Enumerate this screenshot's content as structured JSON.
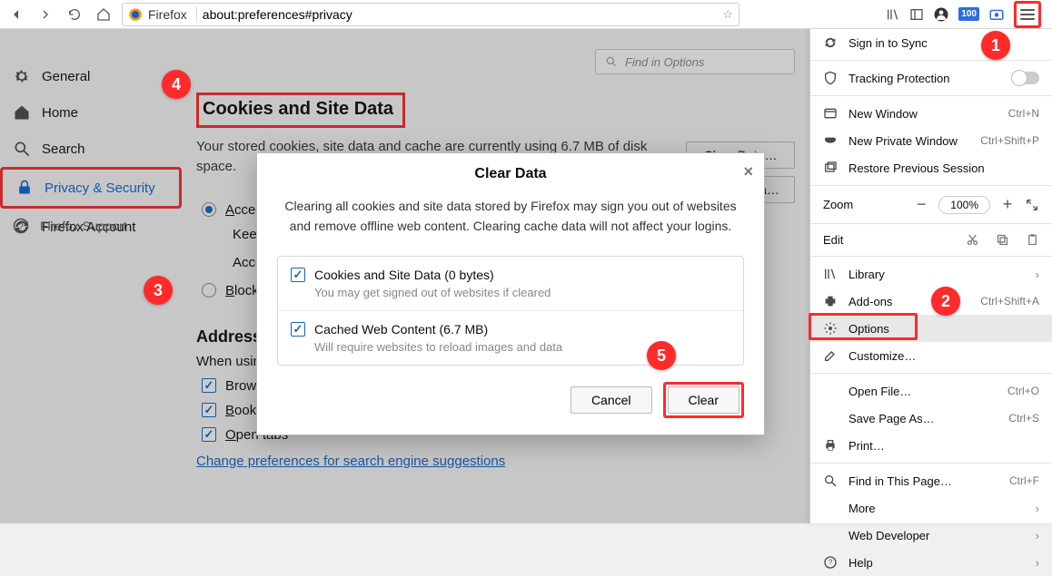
{
  "toolbar": {
    "brand": "Firefox",
    "url": "about:preferences#privacy"
  },
  "prefs": {
    "find_placeholder": "Find in Options",
    "nav": {
      "general": "General",
      "home": "Home",
      "search": "Search",
      "privacy": "Privacy & Security",
      "account": "Firefox Account",
      "support": "Firefox Support"
    },
    "cookies": {
      "title": "Cookies and Site Data",
      "desc": "Your stored cookies, site data and cache are currently using 6.7 MB of disk space.",
      "clear_btn": "Clear Data…",
      "manage_btn": "Manage Data…",
      "radio_accept_prefix": "A",
      "radio_accept_rest": "ccept cookies and site data from websites (recommended)",
      "keep_label": "Keep until",
      "accept_third": "Accept third-party cookies and site data",
      "radio_block_prefix": "B",
      "radio_block_rest": "lock cookies and site data (may cause websites to break)"
    },
    "address": {
      "title": "Address Bar",
      "desc": "When using the address bar, suggest",
      "history": "Browsing history",
      "history_u": "h",
      "bookmarks": "Bookmarks",
      "bookmarks_u": "B",
      "tabs": "pen tabs",
      "tabs_u": "O",
      "link": "Change preferences for search engine suggestions"
    }
  },
  "dialog": {
    "title": "Clear Data",
    "body": "Clearing all cookies and site data stored by Firefox may sign you out of websites and remove offline web content. Clearing cache data will not affect your logins.",
    "opt1_title": "Cookies and Site Data (0 bytes)",
    "opt1_sub": "You may get signed out of websites if cleared",
    "opt2_title": "Cached Web Content (6.7 MB)",
    "opt2_sub": "Will require websites to reload images and data",
    "cancel": "Cancel",
    "clear": "Clear"
  },
  "menu": {
    "sign_in": "Sign in to Sync",
    "tracking": "Tracking Protection",
    "new_window": "New Window",
    "new_window_sc": "Ctrl+N",
    "new_private": "New Private Window",
    "new_private_sc": "Ctrl+Shift+P",
    "restore": "Restore Previous Session",
    "zoom": "Zoom",
    "zoom_val": "100%",
    "edit": "Edit",
    "library": "Library",
    "addons": "Add-ons",
    "addons_sc": "Ctrl+Shift+A",
    "options": "Options",
    "customize": "Customize…",
    "open_file": "Open File…",
    "open_file_sc": "Ctrl+O",
    "save_as": "Save Page As…",
    "save_as_sc": "Ctrl+S",
    "print": "Print…",
    "find": "Find in This Page…",
    "find_sc": "Ctrl+F",
    "more": "More",
    "web_dev": "Web Developer",
    "help": "Help"
  },
  "callouts": {
    "c1": "1",
    "c2": "2",
    "c3": "3",
    "c4": "4",
    "c5": "5"
  }
}
